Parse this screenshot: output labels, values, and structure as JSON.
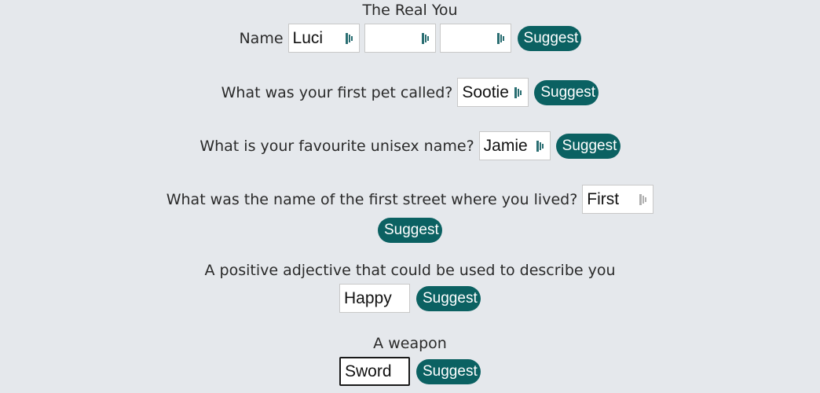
{
  "title": "The Real You",
  "name_row": {
    "label": "Name",
    "fields": [
      {
        "value": "Luci",
        "placeholder": ""
      },
      {
        "value": "",
        "placeholder": ""
      },
      {
        "value": "",
        "placeholder": ""
      }
    ],
    "button": "Suggest"
  },
  "questions": [
    {
      "label": "What was your first pet called?",
      "value": "Sootie",
      "button": "Suggest"
    },
    {
      "label": "What is your favourite unisex name?",
      "value": "Jamie",
      "button": "Suggest"
    },
    {
      "label": "What was the name of the first street where you lived?",
      "value": "First",
      "button": "Suggest"
    },
    {
      "label": "A positive adjective that could be used to describe you",
      "value": "Happy",
      "button": "Suggest"
    },
    {
      "label": "A weapon",
      "value": "Sword",
      "button": "Suggest"
    }
  ],
  "colors": {
    "background": "#e5e8ec",
    "button": "#0b6162",
    "button_text": "#ffffff",
    "password_manager_icon": "#2a6e72"
  },
  "icons": {
    "field_icon": "password-manager-icon"
  }
}
